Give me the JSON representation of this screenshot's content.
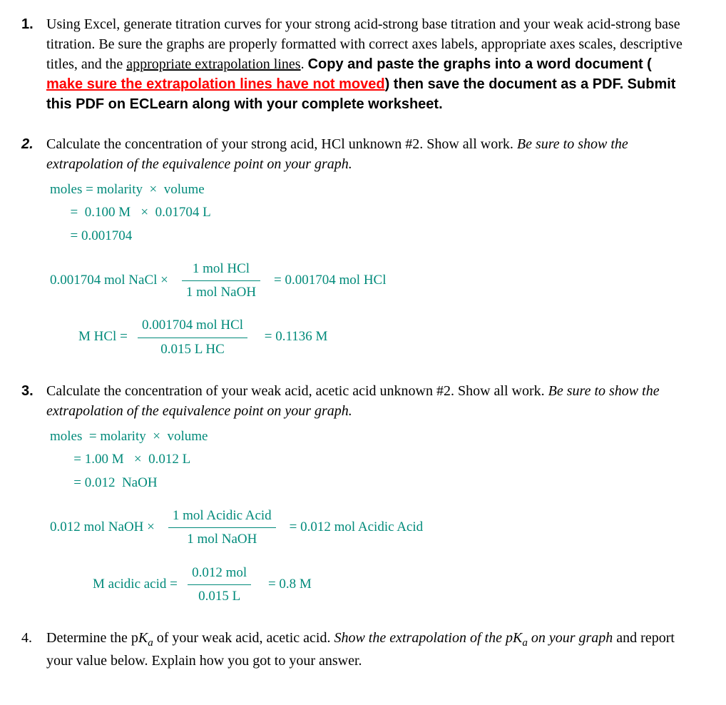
{
  "q1": {
    "num": "1.",
    "text_a": "Using Excel, generate titration curves for your strong acid-strong base titration and your weak acid-strong base titration. Be sure the graphs are properly formatted with correct axes labels, appropriate axes scales, descriptive titles, and the ",
    "under_a": "appropriate extrapolation lines",
    "text_b": ". ",
    "bold_a": "Copy and paste the graphs into a word document ( ",
    "red_under": "make sure the extrapolation lines have not moved",
    "bold_b": ") then save the document as a PDF. Submit this PDF on ECLearn along with your complete worksheet."
  },
  "q2": {
    "num": "2.",
    "text_a": "Calculate the concentration of your strong acid, HCl unknown #2. Show all work. ",
    "italic_a": "Be sure to show the extrapolation of the equivalence point on your graph.",
    "work": {
      "l1": "moles = molarity  ×  volume",
      "l2": "      =  0.100 M   ×  0.01704 L",
      "l3": "      = 0.001704",
      "eq1_left": "0.001704 mol  NaCl  ×",
      "eq1_num": "1 mol HCl",
      "eq1_den": "1 mol NaOH",
      "eq1_right": "= 0.001704 mol  HCl",
      "eq2_left": "M  HCl =",
      "eq2_num": "0.001704 mol  HCl",
      "eq2_den": "0.015 L HC",
      "eq2_right": "=  0.1136 M"
    }
  },
  "q3": {
    "num": "3.",
    "text_a": "Calculate the concentration of your weak acid, acetic acid unknown #2. Show all work. ",
    "italic_a": "Be sure to show the extrapolation of the equivalence point on your graph.",
    "work": {
      "l1": "moles  = molarity  ×  volume",
      "l2": "       = 1.00 M   ×  0.012 L",
      "l3": "       = 0.012  NaOH",
      "eq1_left": "0.012   mol  NaOH   ×",
      "eq1_num": "1 mol  Acidic Acid",
      "eq1_den": "1 mol  NaOH",
      "eq1_right": "=  0.012 mol Acidic Acid",
      "eq2_left": "M  acidic acid  =",
      "eq2_num": "0.012  mol",
      "eq2_den": "0.015  L",
      "eq2_right": "=  0.8  M"
    }
  },
  "q4": {
    "num": "4.",
    "text_a": "Determine the p",
    "ka": "K",
    "sub": "a",
    "text_b": " of your weak acid, acetic acid. ",
    "italic_a": "Show the extrapolation of the pK",
    "italic_sub": "a",
    "italic_b": " on your graph",
    "text_c": " and report your value below. Explain how you got to your answer."
  }
}
